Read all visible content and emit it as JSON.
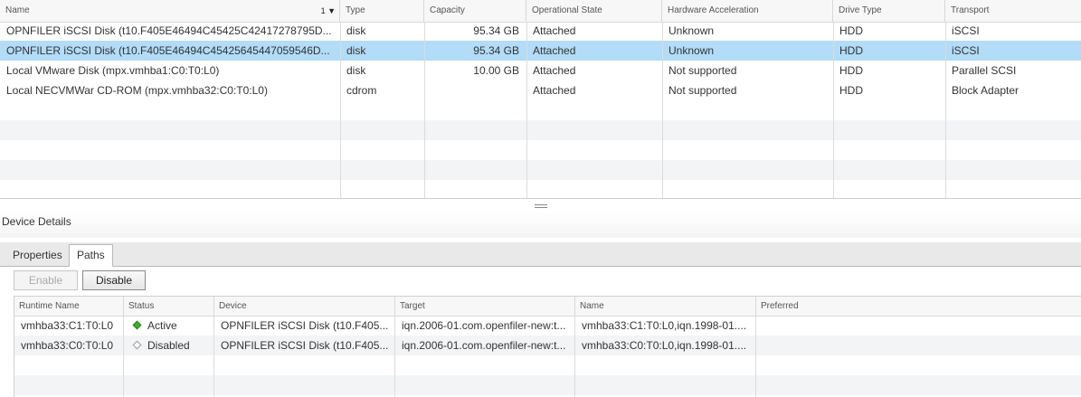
{
  "devices": {
    "columns": [
      {
        "label": "Name",
        "sort": "1 ▼"
      },
      {
        "label": "Type"
      },
      {
        "label": "Capacity"
      },
      {
        "label": "Operational State"
      },
      {
        "label": "Hardware Acceleration"
      },
      {
        "label": "Drive Type"
      },
      {
        "label": "Transport"
      }
    ],
    "rows": [
      {
        "name": "OPNFILER iSCSI Disk (t10.F405E46494C45425C42417278795D...",
        "type": "disk",
        "capacity": "95.34 GB",
        "state": "Attached",
        "hwaccel": "Unknown",
        "drive": "HDD",
        "transport": "iSCSI",
        "selected": false
      },
      {
        "name": "OPNFILER iSCSI Disk (t10.F405E46494C45425645447059546D...",
        "type": "disk",
        "capacity": "95.34 GB",
        "state": "Attached",
        "hwaccel": "Unknown",
        "drive": "HDD",
        "transport": "iSCSI",
        "selected": true
      },
      {
        "name": "Local VMware Disk (mpx.vmhba1:C0:T0:L0)",
        "type": "disk",
        "capacity": "10.00 GB",
        "state": "Attached",
        "hwaccel": "Not supported",
        "drive": "HDD",
        "transport": "Parallel SCSI",
        "selected": false
      },
      {
        "name": "Local NECVMWar CD-ROM (mpx.vmhba32:C0:T0:L0)",
        "type": "cdrom",
        "capacity": "",
        "state": "Attached",
        "hwaccel": "Not supported",
        "drive": "HDD",
        "transport": "Block Adapter",
        "selected": false
      }
    ]
  },
  "details": {
    "title": "Device Details",
    "tabs": [
      "Properties",
      "Paths"
    ],
    "active_tab": "Paths",
    "buttons": {
      "enable": "Enable",
      "disable": "Disable"
    }
  },
  "paths": {
    "columns": [
      "Runtime Name",
      "Status",
      "Device",
      "Target",
      "Name",
      "Preferred"
    ],
    "rows": [
      {
        "runtime": "vmhba33:C1:T0:L0",
        "status": "Active",
        "status_icon": "green-diamond-icon",
        "device": "OPNFILER iSCSI Disk (t10.F405...",
        "target": "iqn.2006-01.com.openfiler-new:t...",
        "name": "vmhba33:C1:T0:L0,iqn.1998-01....",
        "preferred": ""
      },
      {
        "runtime": "vmhba33:C0:T0:L0",
        "status": "Disabled",
        "status_icon": "empty-diamond-icon",
        "device": "OPNFILER iSCSI Disk (t10.F405...",
        "target": "iqn.2006-01.com.openfiler-new:t...",
        "name": "vmhba33:C0:T0:L0,iqn.1998-01....",
        "preferred": ""
      }
    ]
  },
  "colors": {
    "selected_row": "#b2dcf7",
    "active_status": "#3fae2a"
  }
}
